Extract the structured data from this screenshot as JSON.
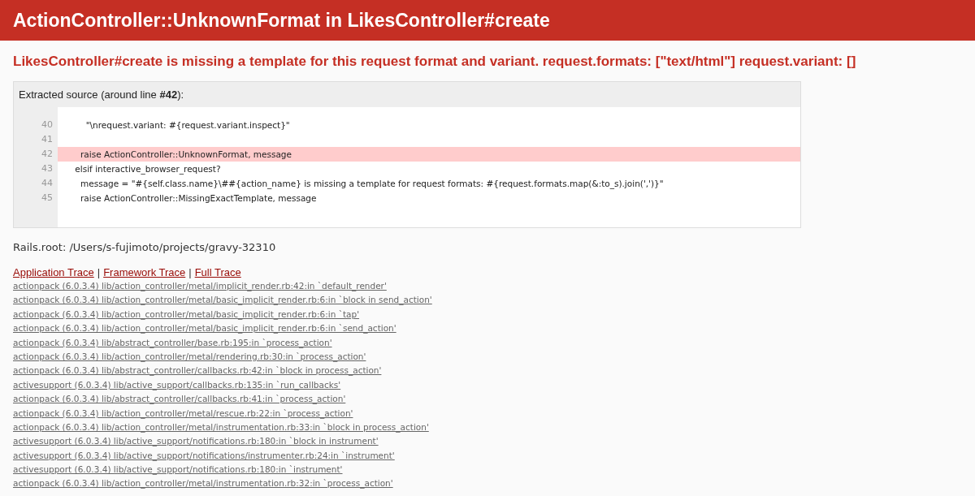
{
  "header": {
    "title": "ActionController::UnknownFormat in LikesController#create"
  },
  "message": "LikesController#create is missing a template for this request format and variant. request.formats: [\"text/html\"] request.variant: []",
  "source": {
    "title": "Extracted source (around line **#42**):",
    "lines": [
      {
        "number": "40",
        "code": "        \"\\nrequest.variant: #{request.variant.inspect}\"",
        "selected": false
      },
      {
        "number": "41",
        "selected": false
      },
      {
        "number": "42",
        "code": "      raise ActionController::UnknownFormat, message",
        "selected": true
      },
      {
        "number": "43",
        "code": "    elsif interactive_browser_request?",
        "selected": false
      },
      {
        "number": "44",
        "code": "      message = \"#{self.class.name}\\##{action_name} is missing a template for request formats: #{request.formats.map(&:to_s).join(',')}\"",
        "selected": false
      },
      {
        "number": "45",
        "code": "      raise ActionController::MissingExactTemplate, message",
        "selected": false
      }
    ]
  },
  "rails_root": "Rails.root: /Users/s-fujimoto/projects/gravy-32310",
  "trace_links": [
    "Application Trace",
    "Framework Trace",
    "Full Trace"
  ],
  "trace_separator": "|",
  "trace": [
    "actionpack (6.0.3.4) lib/action_controller/metal/implicit_render.rb:42:in `default_render'",
    "actionpack (6.0.3.4) lib/action_controller/metal/basic_implicit_render.rb:6:in `block in send_action'",
    "actionpack (6.0.3.4) lib/action_controller/metal/basic_implicit_render.rb:6:in `tap'",
    "actionpack (6.0.3.4) lib/action_controller/metal/basic_implicit_render.rb:6:in `send_action'",
    "actionpack (6.0.3.4) lib/abstract_controller/base.rb:195:in `process_action'",
    "actionpack (6.0.3.4) lib/action_controller/metal/rendering.rb:30:in `process_action'",
    "actionpack (6.0.3.4) lib/abstract_controller/callbacks.rb:42:in `block in process_action'",
    "activesupport (6.0.3.4) lib/active_support/callbacks.rb:135:in `run_callbacks'",
    "actionpack (6.0.3.4) lib/abstract_controller/callbacks.rb:41:in `process_action'",
    "actionpack (6.0.3.4) lib/action_controller/metal/rescue.rb:22:in `process_action'",
    "actionpack (6.0.3.4) lib/action_controller/metal/instrumentation.rb:33:in `block in process_action'",
    "activesupport (6.0.3.4) lib/active_support/notifications.rb:180:in `block in instrument'",
    "activesupport (6.0.3.4) lib/active_support/notifications/instrumenter.rb:24:in `instrument'",
    "activesupport (6.0.3.4) lib/active_support/notifications.rb:180:in `instrument'",
    "actionpack (6.0.3.4) lib/action_controller/metal/instrumentation.rb:32:in `process_action'"
  ]
}
